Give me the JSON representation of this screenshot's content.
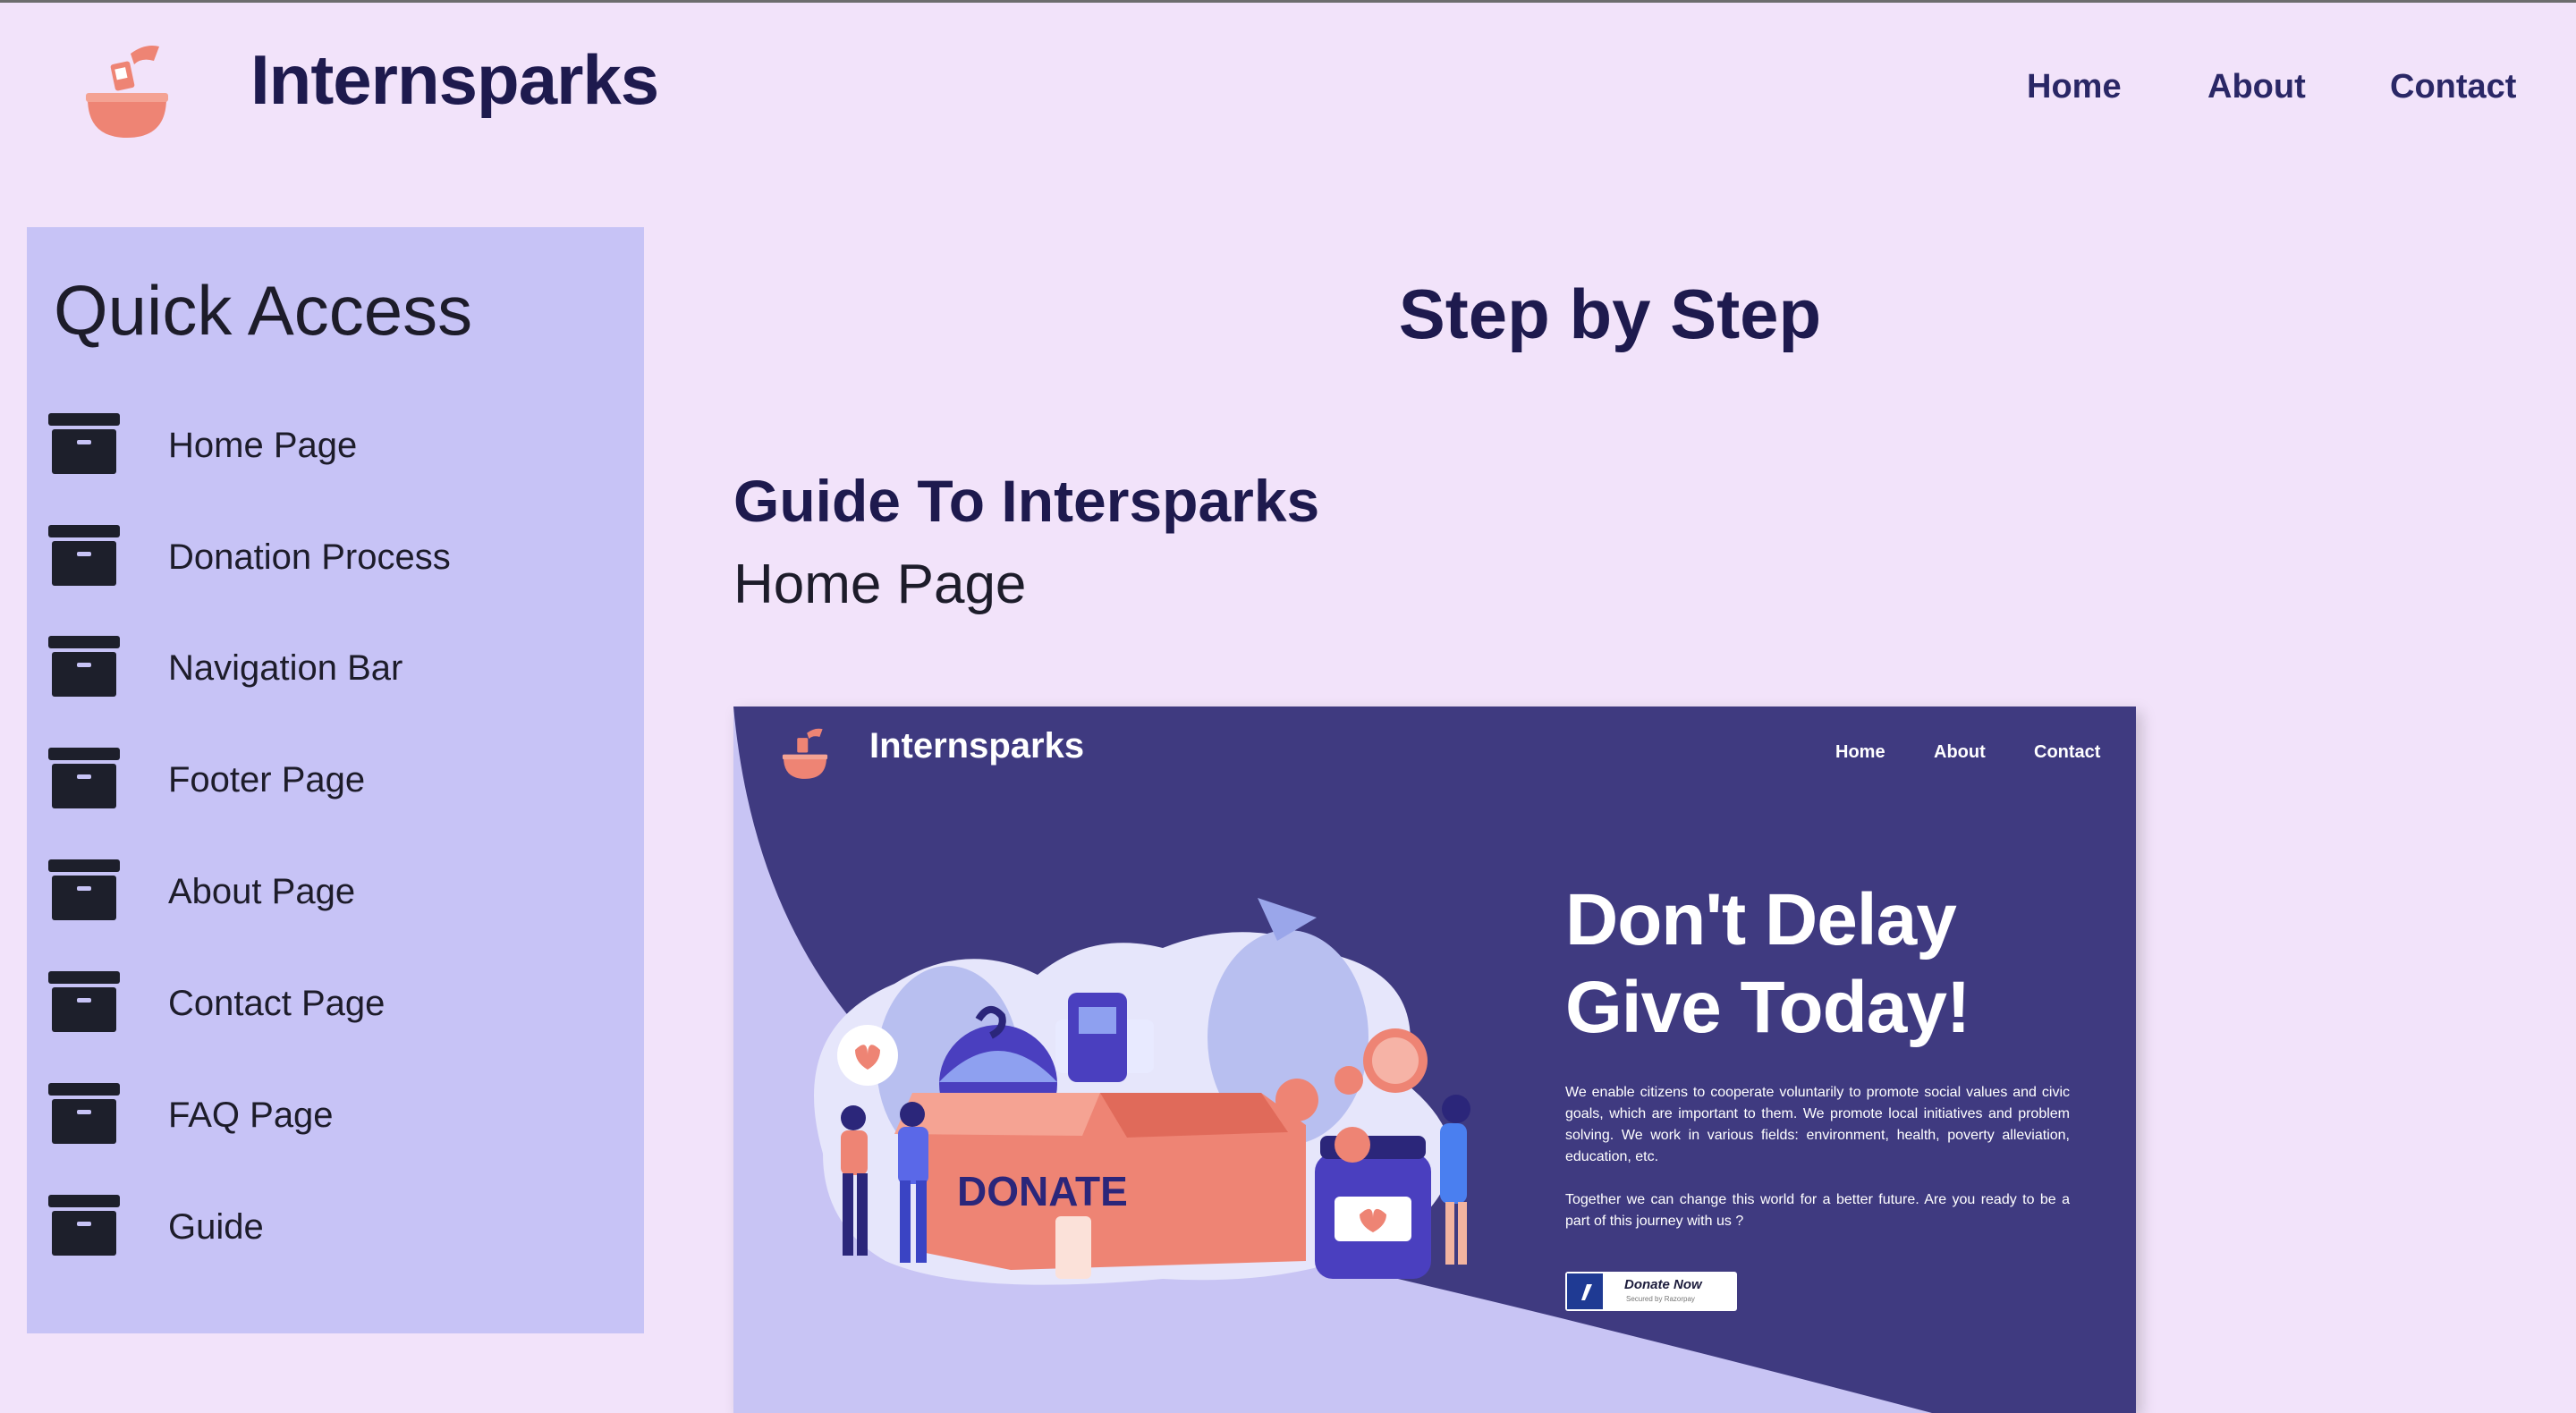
{
  "header": {
    "brand": "Internsparks",
    "logo_icon": "donation-bowl-icon",
    "nav": [
      "Home",
      "About",
      "Contact"
    ]
  },
  "sidebar": {
    "title": "Quick Access",
    "item_icon": "archive-box-icon",
    "items": [
      {
        "label": "Home Page"
      },
      {
        "label": "Donation Process"
      },
      {
        "label": "Navigation Bar"
      },
      {
        "label": "Footer Page"
      },
      {
        "label": "About Page"
      },
      {
        "label": "Contact Page"
      },
      {
        "label": "FAQ Page"
      },
      {
        "label": "Guide"
      }
    ]
  },
  "main": {
    "title": "Step by Step",
    "guide_title": "Guide To Intersparks",
    "guide_subtitle": "Home Page"
  },
  "preview": {
    "brand": "Internsparks",
    "nav": [
      "Home",
      "About",
      "Contact"
    ],
    "headline_line1": "Don't Delay",
    "headline_line2": "Give Today!",
    "paragraph1": "We enable citizens to cooperate voluntarily to promote social values and civic goals, which are important to them. We promote local initiatives and problem solving. We work in various fields: environment, health, poverty alleviation, education, etc.",
    "paragraph2": "Together we can change this world for a better future. Are you ready to be a part of this journey with us ?",
    "donate_button": "Donate Now",
    "donate_sub": "Secured by Razorpay",
    "box_label": "DONATE"
  },
  "colors": {
    "page_bg": "#f2e3fa",
    "sidebar_bg": "#c7c3f6",
    "text_dark": "#1e1a4e",
    "preview_purple": "#3f3a80",
    "accent_salmon": "#ee8474"
  }
}
